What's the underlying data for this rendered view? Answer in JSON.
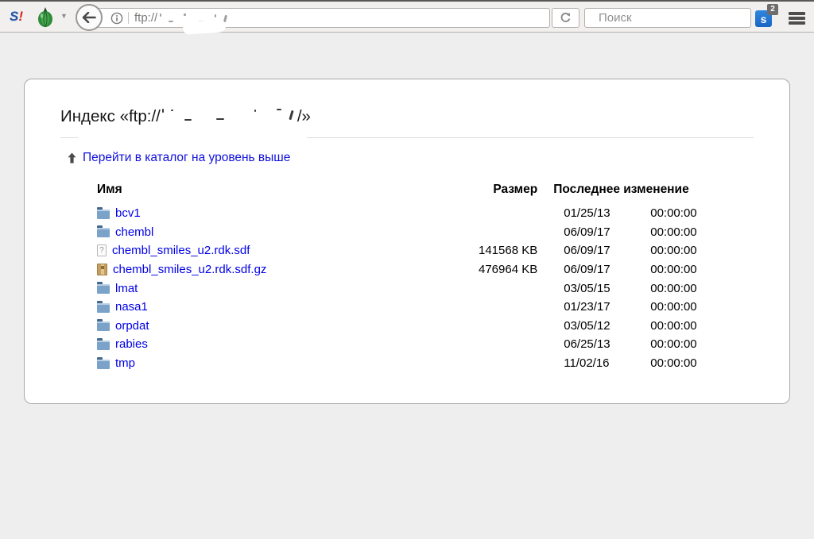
{
  "colors": {
    "link_blue": "#0000e8",
    "folder_blue": "#7ba2c9",
    "archive_tan": "#c59e62",
    "extension_blue": "#1a66c4",
    "toolbar_bg": "#f2f0ee",
    "page_bg": "#efeeee"
  },
  "browser": {
    "logo": {
      "s": "S",
      "excl": "!"
    },
    "icons": {
      "chevron_down": "▼"
    },
    "url": {
      "visible_text": "ftp://",
      "redacted": true
    },
    "search": {
      "placeholder": "Поиск"
    },
    "extension": {
      "label": "s",
      "badge": "2"
    }
  },
  "page": {
    "title_prefix": "Индекс «ftp://",
    "title_suffix": "/»",
    "parent_link_label": "Перейти в каталог на уровень выше",
    "table": {
      "headers": {
        "name": "Имя",
        "size": "Размер",
        "modified": "Последнее изменение"
      },
      "rows": [
        {
          "icon": "folder",
          "name": "bcv1",
          "size": "",
          "date": "01/25/13",
          "time": "00:00:00"
        },
        {
          "icon": "folder",
          "name": "chembl",
          "size": "",
          "date": "06/09/17",
          "time": "00:00:00"
        },
        {
          "icon": "file-unknown",
          "name": "chembl_smiles_u2.rdk.sdf",
          "size": "141568 KB",
          "date": "06/09/17",
          "time": "00:00:00"
        },
        {
          "icon": "archive",
          "name": "chembl_smiles_u2.rdk.sdf.gz",
          "size": "476964 KB",
          "date": "06/09/17",
          "time": "00:00:00"
        },
        {
          "icon": "folder",
          "name": "lmat",
          "size": "",
          "date": "03/05/15",
          "time": "00:00:00"
        },
        {
          "icon": "folder",
          "name": "nasa1",
          "size": "",
          "date": "01/23/17",
          "time": "00:00:00"
        },
        {
          "icon": "folder",
          "name": "orpdat",
          "size": "",
          "date": "03/05/12",
          "time": "00:00:00"
        },
        {
          "icon": "folder",
          "name": "rabies",
          "size": "",
          "date": "06/25/13",
          "time": "00:00:00"
        },
        {
          "icon": "folder",
          "name": "tmp",
          "size": "",
          "date": "11/02/16",
          "time": "00:00:00"
        }
      ]
    }
  }
}
